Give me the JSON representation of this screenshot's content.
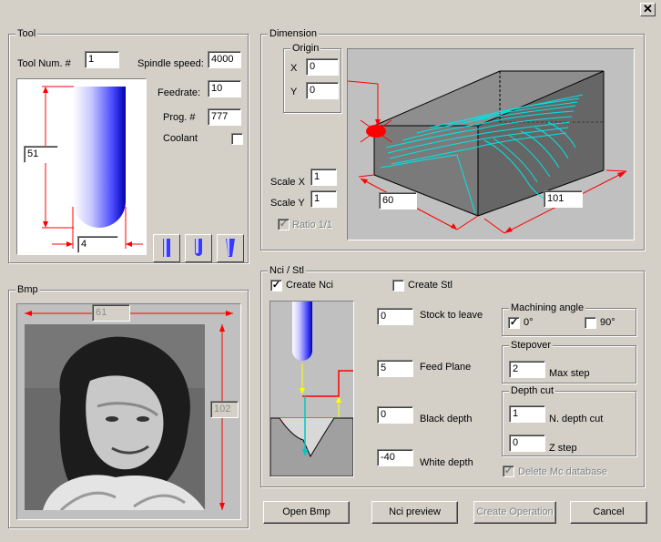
{
  "window": {
    "close_glyph": "✕"
  },
  "tool": {
    "group_title": "Tool",
    "tool_num_label": "Tool Num. #",
    "tool_num_value": "1",
    "spindle_speed_label": "Spindle speed:",
    "spindle_speed_value": "4000",
    "feedrate_label": "Feedrate:",
    "feedrate_value": "10",
    "prog_label": "Prog. #",
    "prog_value": "777",
    "coolant_label": "Coolant",
    "coolant_checked": "",
    "length_value": "51",
    "diameter_value": "4"
  },
  "dimension": {
    "group_title": "Dimension",
    "origin_title": "Origin",
    "x_label": "X",
    "x_value": "0",
    "y_label": "Y",
    "y_value": "0",
    "scale_x_label": "Scale X",
    "scale_x_value": "1",
    "scale_y_label": "Scale Y",
    "scale_y_value": "1",
    "ratio_label": "Ratio 1/1",
    "ratio_checked": "✓",
    "depth_value": "60",
    "width_value": "101"
  },
  "bmp": {
    "group_title": "Bmp",
    "width_value": "61",
    "height_value": "102"
  },
  "nci_stl": {
    "group_title": "Nci / Stl",
    "create_nci_label": "Create Nci",
    "create_nci_checked": "✓",
    "create_stl_label": "Create Stl",
    "create_stl_checked": "",
    "stock_to_leave_value": "0",
    "stock_to_leave_label": "Stock to leave",
    "feed_plane_value": "5",
    "feed_plane_label": "Feed Plane",
    "black_depth_value": "0",
    "black_depth_label": "Black depth",
    "white_depth_value": "-40",
    "white_depth_label": "White depth",
    "machining_angle_title": "Machining angle",
    "angle_0_label": "0°",
    "angle_0_checked": "✓",
    "angle_90_label": "90°",
    "angle_90_checked": "",
    "stepover_title": "Stepover",
    "max_step_value": "2",
    "max_step_label": "Max step",
    "depth_cut_title": "Depth cut",
    "n_depth_cut_value": "1",
    "n_depth_cut_label": "N. depth cut",
    "z_step_value": "0",
    "z_step_label": "Z step",
    "delete_db_label": "Delete Mc database",
    "delete_db_checked": "✓"
  },
  "buttons": {
    "open_bmp": "Open Bmp",
    "nci_preview": "Nci preview",
    "create_operation": "Create Operation",
    "cancel": "Cancel"
  },
  "colors": {
    "background": "#d4d0c8",
    "tool_blue": "#1a1aff",
    "toolpath_cyan": "#00e5e5",
    "dimension_red": "#ff0000",
    "feed_yellow": "#ffff00"
  }
}
